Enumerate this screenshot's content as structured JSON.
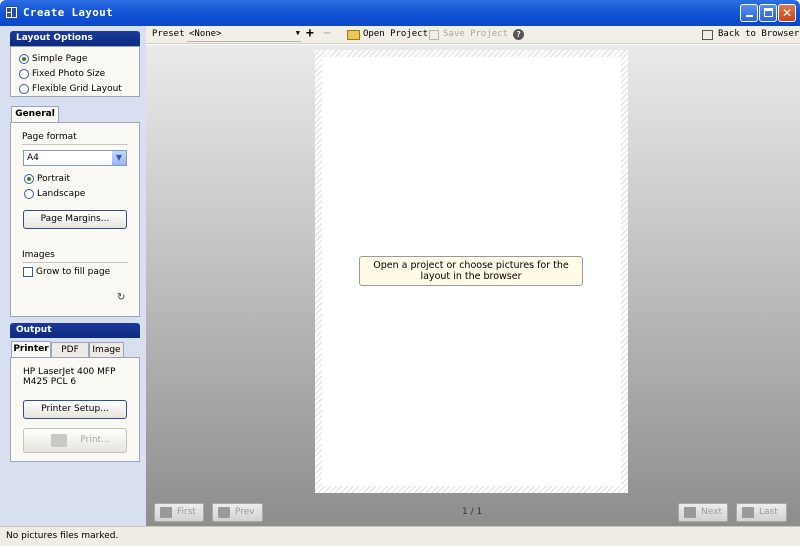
{
  "window": {
    "title": "Create Layout"
  },
  "layout_options": {
    "header": "Layout Options",
    "options": [
      "Simple Page",
      "Fixed Photo Size",
      "Flexible Grid Layout"
    ],
    "selected": "Simple Page"
  },
  "general": {
    "tab": "General",
    "page_format_label": "Page format",
    "page_format_value": "A4",
    "orientation": [
      "Portrait",
      "Landscape"
    ],
    "orientation_selected": "Portrait",
    "page_margins_button": "Page Margins...",
    "images_label": "Images",
    "grow_to_fill": "Grow to fill page"
  },
  "output": {
    "header": "Output",
    "tabs": [
      "Printer",
      "PDF",
      "Image"
    ],
    "active_tab": "Printer",
    "printer_name_line1": "HP LaserJet 400 MFP",
    "printer_name_line2": "M425 PCL 6",
    "printer_setup_button": "Printer Setup...",
    "print_button": "Print..."
  },
  "toolbar": {
    "preset_label": "Preset",
    "preset_value": "<None>",
    "open_project": "Open Project",
    "save_project": "Save Project",
    "back_to_browser": "Back to Browser"
  },
  "canvas": {
    "hint": "Open a project or choose pictures for the layout in the browser",
    "page_indicator": "1 / 1",
    "nav": {
      "first": "First",
      "prev": "Prev",
      "next": "Next",
      "last": "Last"
    }
  },
  "status": {
    "text": "No pictures files marked."
  },
  "colors": {
    "panel_header": "#0d2b80",
    "titlebar": "#1355d6",
    "panel_bg": "#d7dff0"
  }
}
